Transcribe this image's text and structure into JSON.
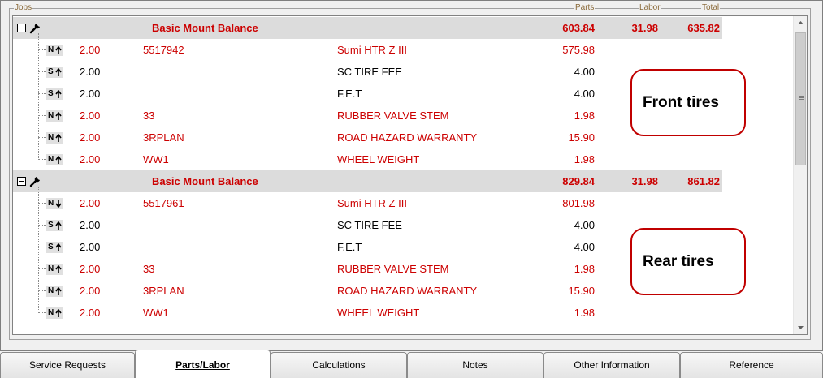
{
  "headers": {
    "jobs": "Jobs",
    "parts": "Parts",
    "labor": "Labor",
    "total": "Total"
  },
  "jobs": [
    {
      "title": "Basic Mount Balance",
      "parts": "603.84",
      "labor": "31.98",
      "total": "635.82",
      "lines": [
        {
          "badge": "N",
          "arrow": "up",
          "qty": "2.00",
          "part": "5517942",
          "desc": "Sumi HTR Z III",
          "amount": "575.98",
          "color": "red"
        },
        {
          "badge": "S",
          "arrow": "up",
          "qty": "2.00",
          "part": "",
          "desc": "SC TIRE FEE",
          "amount": "4.00",
          "color": "black"
        },
        {
          "badge": "S",
          "arrow": "up",
          "qty": "2.00",
          "part": "",
          "desc": "F.E.T",
          "amount": "4.00",
          "color": "black"
        },
        {
          "badge": "N",
          "arrow": "up",
          "qty": "2.00",
          "part": "33",
          "desc": "RUBBER VALVE STEM",
          "amount": "1.98",
          "color": "red"
        },
        {
          "badge": "N",
          "arrow": "up",
          "qty": "2.00",
          "part": "3RPLAN",
          "desc": "ROAD HAZARD WARRANTY",
          "amount": "15.90",
          "color": "red"
        },
        {
          "badge": "N",
          "arrow": "up",
          "qty": "2.00",
          "part": "WW1",
          "desc": "WHEEL WEIGHT",
          "amount": "1.98",
          "color": "red"
        }
      ]
    },
    {
      "title": "Basic Mount Balance",
      "parts": "829.84",
      "labor": "31.98",
      "total": "861.82",
      "lines": [
        {
          "badge": "N",
          "arrow": "down",
          "qty": "2.00",
          "part": "5517961",
          "desc": "Sumi HTR Z III",
          "amount": "801.98",
          "color": "red"
        },
        {
          "badge": "S",
          "arrow": "up",
          "qty": "2.00",
          "part": "",
          "desc": "SC TIRE FEE",
          "amount": "4.00",
          "color": "black"
        },
        {
          "badge": "S",
          "arrow": "up",
          "qty": "2.00",
          "part": "",
          "desc": "F.E.T",
          "amount": "4.00",
          "color": "black"
        },
        {
          "badge": "N",
          "arrow": "up",
          "qty": "2.00",
          "part": "33",
          "desc": "RUBBER VALVE STEM",
          "amount": "1.98",
          "color": "red"
        },
        {
          "badge": "N",
          "arrow": "up",
          "qty": "2.00",
          "part": "3RPLAN",
          "desc": "ROAD HAZARD WARRANTY",
          "amount": "15.90",
          "color": "red"
        },
        {
          "badge": "N",
          "arrow": "up",
          "qty": "2.00",
          "part": "WW1",
          "desc": "WHEEL WEIGHT",
          "amount": "1.98",
          "color": "red"
        }
      ]
    }
  ],
  "callouts": {
    "front": "Front tires",
    "rear": "Rear tires"
  },
  "tabs": [
    {
      "label": "Service Requests",
      "active": false
    },
    {
      "label": "Parts/Labor",
      "active": true
    },
    {
      "label": "Calculations",
      "active": false
    },
    {
      "label": "Notes",
      "active": false
    },
    {
      "label": "Other Information",
      "active": false
    },
    {
      "label": "Reference",
      "active": false
    }
  ],
  "colors": {
    "accent_red": "#cc0000",
    "job_row_bg": "#dcdcdc",
    "callout_border": "#c00000"
  }
}
